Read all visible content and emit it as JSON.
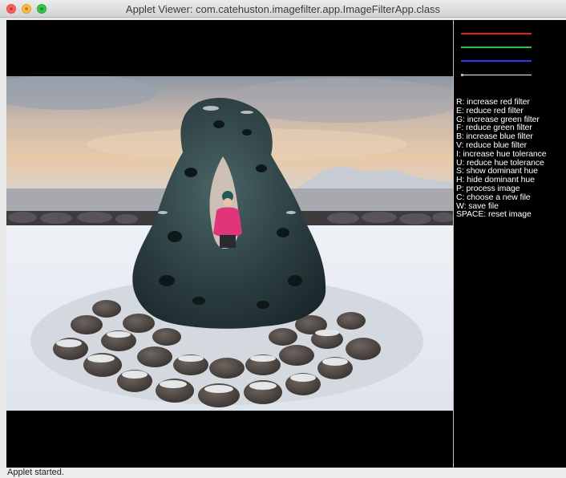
{
  "window": {
    "title": "Applet Viewer: com.catehuston.imagefilter.app.ImageFilterApp.class"
  },
  "filter_lines": [
    {
      "name": "red",
      "color": "#d8251e"
    },
    {
      "name": "green",
      "color": "#33c23a"
    },
    {
      "name": "blue",
      "color": "#2c3cff"
    },
    {
      "name": "hue",
      "color": "#f0f0f0"
    }
  ],
  "keyboard_help": [
    "R: increase red filter",
    "E: reduce red filter",
    "G: increase green filter",
    "F: reduce green filter",
    "B: increase blue filter",
    "V: reduce blue filter",
    "I: increase hue tolerance",
    "U: reduce hue tolerance",
    "S: show dominant hue",
    "H: hide dominant hue",
    "P: process image",
    "C: choose a new file",
    "W: save file",
    "SPACE: reset image"
  ],
  "status": {
    "text": "Applet started."
  }
}
